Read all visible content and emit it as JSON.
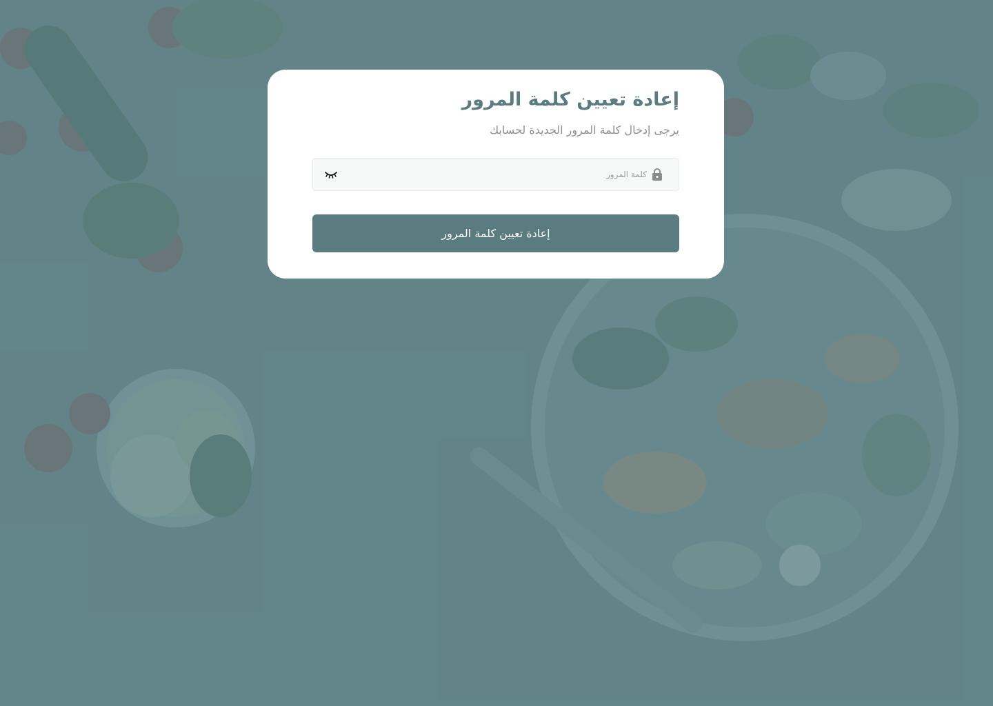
{
  "page": {
    "background_tint": "#608388",
    "accent_color": "#5a7b80"
  },
  "card": {
    "title": "إعادة تعيين كلمة المرور",
    "subtitle": "يرجى إدخال كلمة المرور الجديدة لحسابك",
    "password_field": {
      "placeholder": "كلمة المرور",
      "value": "",
      "leading_icon": "lock-icon",
      "toggle_icon": "eye-closed-icon"
    },
    "submit_label": "إعادة تعيين كلمة المرور"
  }
}
